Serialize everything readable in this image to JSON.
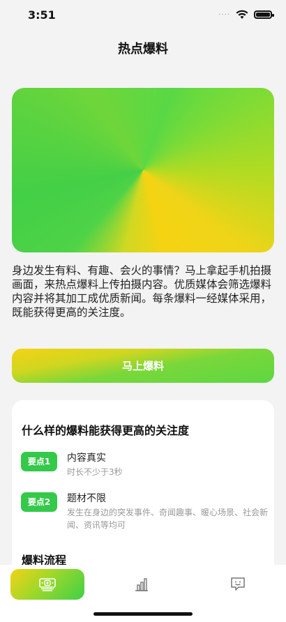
{
  "status_bar": {
    "time": "3:51",
    "signal_dots": "····"
  },
  "header": {
    "title": "热点爆料"
  },
  "intro": {
    "text": "身边发生有料、有趣、会火的事情？马上拿起手机拍摄画面，来热点爆料上传拍摄内容。优质媒体会筛选爆料内容并将其加工成优质新闻。每条爆料一经媒体采用，既能获得更高的关注度。"
  },
  "cta": {
    "label": "马上爆料"
  },
  "card": {
    "heading": "什么样的爆料能获得更高的关注度",
    "points": [
      {
        "badge": "要点1",
        "title": "内容真实",
        "desc": "时长不少于3秒"
      },
      {
        "badge": "要点2",
        "title": "题材不限",
        "desc": "发生在身边的突发事件、奇闻趣事、暖心场景、社会新闻、资讯等均可"
      }
    ],
    "flow_heading": "爆料流程"
  },
  "tabbar": {
    "tabs": [
      {
        "icon": "camera-icon",
        "active": true
      },
      {
        "icon": "bar-chart-icon",
        "active": false
      },
      {
        "icon": "feedback-icon",
        "active": false
      }
    ]
  },
  "colors": {
    "accent_green": "#34c949",
    "accent_yellow": "#f3d315"
  }
}
